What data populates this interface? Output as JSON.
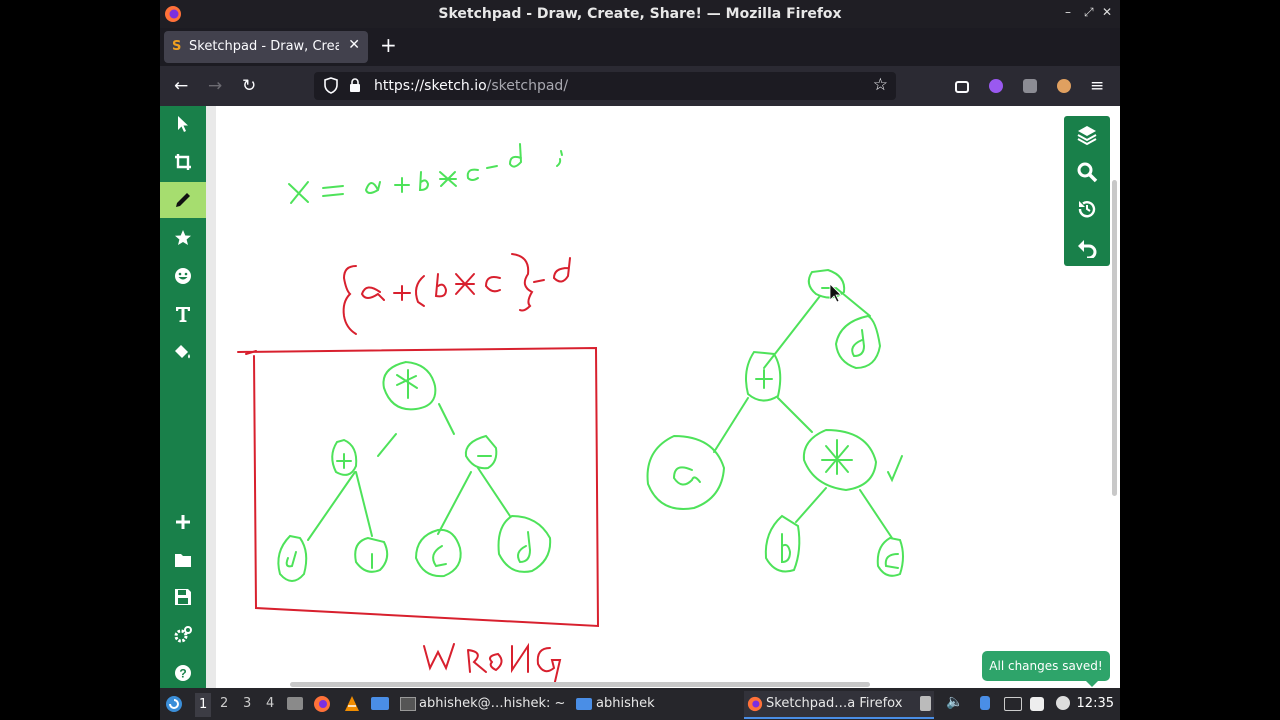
{
  "window": {
    "title": "Sketchpad - Draw, Create, Share! — Mozilla Firefox"
  },
  "tab": {
    "label": "Sketchpad - Draw, Create, Share!",
    "favicon": "S"
  },
  "url": {
    "host": "https://sketch.io",
    "path": "/sketchpad/"
  },
  "left_tools": [
    "select-icon",
    "crop-icon",
    "pencil-icon",
    "star-icon",
    "emoji-icon",
    "text-icon",
    "fill-icon",
    "add-icon",
    "folder-icon",
    "save-icon",
    "settings-icon",
    "help-icon"
  ],
  "right_tools": [
    "layers-icon",
    "search-icon",
    "history-icon",
    "undo-icon"
  ],
  "toast": "All changes saved!",
  "taskbar": {
    "workspaces": [
      "1",
      "2",
      "3",
      "4"
    ],
    "terminal": "abhishek@…hishek: ~",
    "files": "abhishek",
    "browser": "Sketchpad…a Firefox",
    "clock": "12:35"
  },
  "drawing": {
    "equation": "x = a+b*c-d;",
    "bracketed": "{a+(b*c}-d",
    "wrong_label": "WRONG",
    "wrong_tree": {
      "root": "*",
      "left": "+",
      "right": "-",
      "leaves": [
        "a",
        "b",
        "c",
        "d"
      ]
    },
    "correct_tree": {
      "root": "-",
      "plus": "+",
      "mult": "*",
      "leaves": [
        "a",
        "b",
        "c",
        "d"
      ]
    },
    "check": "✓"
  },
  "colors": {
    "accent_green": "#19804a",
    "active_tool": "#a6dd6f",
    "ink_green": "#4ee25a",
    "ink_red": "#d8202e"
  }
}
